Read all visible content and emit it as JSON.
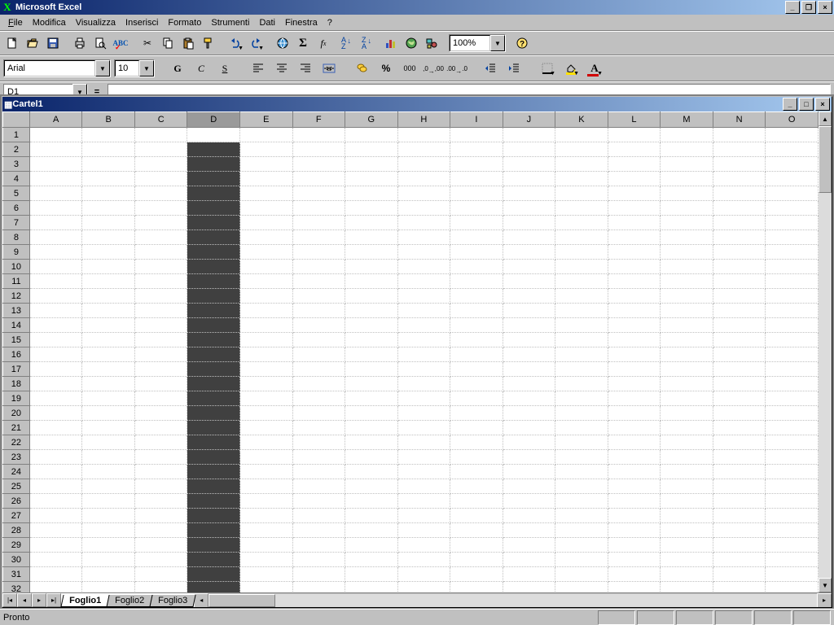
{
  "app": {
    "title": "Microsoft Excel"
  },
  "menu": {
    "file": "File",
    "edit": "Modifica",
    "view": "Visualizza",
    "insert": "Inserisci",
    "format": "Formato",
    "tools": "Strumenti",
    "data": "Dati",
    "window": "Finestra",
    "help": "?"
  },
  "toolbar": {
    "zoom": "100%"
  },
  "format": {
    "font": "Arial",
    "size": "10",
    "bold": "G",
    "italic": "C",
    "underline": "S",
    "percent": "%",
    "thousands": "000",
    "inc_dec_a": ",0",
    "inc_dec_b": ",00",
    "pill1": ".00",
    "pill2": ".0"
  },
  "namebox": {
    "ref": "D1",
    "eq": "="
  },
  "workbook": {
    "title": "Cartel1"
  },
  "columns": [
    "A",
    "B",
    "C",
    "D",
    "E",
    "F",
    "G",
    "H",
    "I",
    "J",
    "K",
    "L",
    "M",
    "N",
    "O"
  ],
  "row_count": 33,
  "selected_column_index": 3,
  "active_row": 1,
  "sheets": {
    "active": "Foglio1",
    "others": [
      "Foglio2",
      "Foglio3"
    ]
  },
  "status": {
    "ready": "Pronto"
  }
}
